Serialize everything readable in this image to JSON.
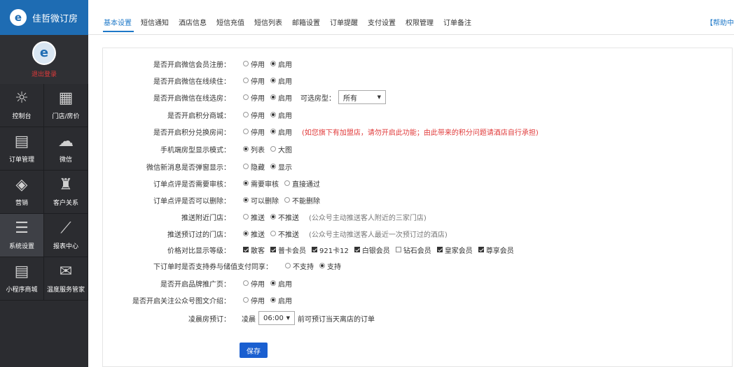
{
  "brand": {
    "name": "佳哲微订房",
    "logo_glyph": "e"
  },
  "user": {
    "logout_label": "退出登录",
    "avatar_glyph": "e"
  },
  "sidebar": {
    "items": [
      {
        "label": "控制台",
        "icon": "☼"
      },
      {
        "label": "门店/房价",
        "icon": "▦"
      },
      {
        "label": "订单管理",
        "icon": "▤"
      },
      {
        "label": "微信",
        "icon": "☁"
      },
      {
        "label": "营销",
        "icon": "◈"
      },
      {
        "label": "客户关系",
        "icon": "♜"
      },
      {
        "label": "系统设置",
        "icon": "☰"
      },
      {
        "label": "报表中心",
        "icon": "⟋"
      },
      {
        "label": "小程序商城",
        "icon": "▤"
      },
      {
        "label": "温度服务管家",
        "icon": "✉"
      }
    ]
  },
  "tabs": [
    "基本设置",
    "短信通知",
    "酒店信息",
    "短信充值",
    "短信列表",
    "邮箱设置",
    "订单提醒",
    "支付设置",
    "权限管理",
    "订单备注"
  ],
  "help_label": "【帮助中",
  "form": {
    "r1": {
      "label": "是否开启微信会员注册：",
      "a": "停用",
      "b": "启用"
    },
    "r2": {
      "label": "是否开启微信在线续住：",
      "a": "停用",
      "b": "启用"
    },
    "r3": {
      "label": "是否开启微信在线选房：",
      "a": "停用",
      "b": "启用",
      "extra_label": "可选房型：",
      "select": "所有"
    },
    "r4": {
      "label": "是否开启积分商城：",
      "a": "停用",
      "b": "启用"
    },
    "r5": {
      "label": "是否开启积分兑换房间：",
      "a": "停用",
      "b": "启用",
      "note": "(如您旗下有加盟店，请勿开启此功能；由此带来的积分问题请酒店自行承担)"
    },
    "r6": {
      "label": "手机端房型显示模式：",
      "a": "列表",
      "b": "大图"
    },
    "r7": {
      "label": "微信新消息是否弹窗显示：",
      "a": "隐藏",
      "b": "显示"
    },
    "r8": {
      "label": "订单点评是否需要审核：",
      "a": "需要审核",
      "b": "直接通过"
    },
    "r9": {
      "label": "订单点评是否可以删除：",
      "a": "可以删除",
      "b": "不能删除"
    },
    "r10": {
      "label": "推送附近门店：",
      "a": "推送",
      "b": "不推送",
      "hint": "(公众号主动推送客人附近的三家门店)"
    },
    "r11": {
      "label": "推送预订过的门店：",
      "a": "推送",
      "b": "不推送",
      "hint": "(公众号主动推送客人最近一次预订过的酒店)"
    },
    "r12": {
      "label": "价格对比显示等级：",
      "levels": [
        "散客",
        "普卡会员",
        "921卡12",
        "白银会员",
        "钻石会员",
        "皇家会员",
        "尊享会员"
      ]
    },
    "r13": {
      "label": "下订单时是否支持券与储值支付同享：",
      "a": "不支持",
      "b": "支持"
    },
    "r14": {
      "label": "是否开启品牌推广页：",
      "a": "停用",
      "b": "启用"
    },
    "r15": {
      "label": "是否开启关注公众号图文介绍：",
      "a": "停用",
      "b": "启用"
    },
    "r16": {
      "label": "凌晨房预订：",
      "prefix": "凌晨",
      "select": "06:00",
      "suffix": "前可预订当天离店的订单"
    }
  },
  "save_label": "保存"
}
